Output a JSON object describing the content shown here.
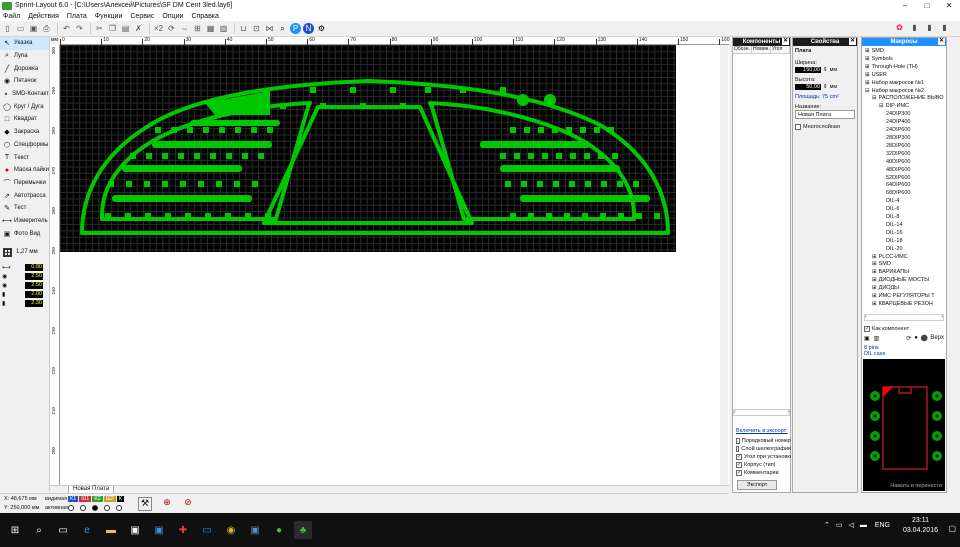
{
  "window": {
    "title": "Sprint-Layout 6.0 - [C:\\Users\\Алексей\\Pictures\\SF DM Cent 3led.lay6]"
  },
  "menu": [
    "Файл",
    "Действия",
    "Плата",
    "Функции",
    "Сервис",
    "Опции",
    "Справка"
  ],
  "tools": [
    {
      "label": "Указка",
      "icon": "pointer-icon",
      "selected": true
    },
    {
      "label": "Лупа",
      "icon": "magnifier-icon"
    },
    {
      "label": "Дорожка",
      "icon": "track-icon"
    },
    {
      "label": "Пятачок",
      "icon": "pad-icon"
    },
    {
      "label": "SMD-Контакт",
      "icon": "smd-pad-icon"
    },
    {
      "label": "Круг / Дуга",
      "icon": "circle-arc-icon"
    },
    {
      "label": "Квадрат",
      "icon": "square-icon"
    },
    {
      "label": "Закраска",
      "icon": "fill-icon"
    },
    {
      "label": "Спецформы",
      "icon": "special-shapes-icon"
    },
    {
      "label": "Текст",
      "icon": "text-icon"
    },
    {
      "label": "Маска пайки",
      "icon": "solder-mask-icon"
    },
    {
      "label": "Перемычки",
      "icon": "jumper-icon"
    },
    {
      "label": "Автотрасса",
      "icon": "autoroute-icon"
    },
    {
      "label": "Тест",
      "icon": "test-icon"
    },
    {
      "label": "Измеритель",
      "icon": "measure-icon"
    },
    {
      "label": "Фото Вид",
      "icon": "photo-view-icon"
    }
  ],
  "grid": {
    "label": "1,27 мм"
  },
  "widths": [
    "0.80",
    "2.50",
    "2.50",
    "2.00",
    "2.30"
  ],
  "ruler": {
    "unit": "мм",
    "ticks": [
      "0",
      "10",
      "20",
      "30",
      "40",
      "50",
      "60",
      "70",
      "80",
      "90",
      "100",
      "110",
      "120",
      "130",
      "140",
      "150",
      "160"
    ]
  },
  "ruler_left": [
    "300",
    "290",
    "280",
    "270",
    "260",
    "250",
    "240",
    "230",
    "220",
    "210",
    "200"
  ],
  "tab": "Новая Плата",
  "status": {
    "x": "48,675 мм",
    "y": "250,000 мм",
    "visible_label": "видимая",
    "active_label": "активная",
    "layers": [
      "К1",
      "Ш1",
      "К2",
      "Ш2",
      "К"
    ]
  },
  "components": {
    "title": "Компоненты",
    "cols": [
      "Обозн.",
      "Номин.",
      "Угол"
    ],
    "export_link": "Включить в экспорт:",
    "options": [
      {
        "label": "Порядковый номер",
        "checked": false
      },
      {
        "label": "Слой шелкографии",
        "checked": false
      },
      {
        "label": "Угол при установке",
        "checked": true
      },
      {
        "label": "Корпус (тип)",
        "checked": true
      },
      {
        "label": "Комментарии",
        "checked": true
      }
    ],
    "export_button": "Экспорт"
  },
  "properties": {
    "title": "Свойства",
    "section": "Плата",
    "width_label": "Ширина:",
    "width": "150,00",
    "height_label": "Высота:",
    "height": "50,00",
    "unit": "мм",
    "area": "Площадь: 75 cm²",
    "name_label": "Название:",
    "name": "Новая Плата",
    "multilayer": "Многослойная"
  },
  "macros": {
    "title": "Макросы",
    "tree": [
      {
        "t": "SMD",
        "d": 0,
        "s": "+"
      },
      {
        "t": "Symbols",
        "d": 0,
        "s": "+"
      },
      {
        "t": "Through-Hole (TH)",
        "d": 0,
        "s": "+"
      },
      {
        "t": "USER",
        "d": 0,
        "s": "+"
      },
      {
        "t": "Набор макросов №1",
        "d": 0,
        "s": "+"
      },
      {
        "t": "Набор макросов №2",
        "d": 0,
        "s": "-"
      },
      {
        "t": "РАСПОЛОЖЕНИЕ ВЫВО",
        "d": 1,
        "s": "-"
      },
      {
        "t": "DIP-ИМС",
        "d": 2,
        "s": "-"
      },
      {
        "t": "24DIP300",
        "d": 3,
        "s": ""
      },
      {
        "t": "24DIP400",
        "d": 3,
        "s": ""
      },
      {
        "t": "24DIP600",
        "d": 3,
        "s": ""
      },
      {
        "t": "28DIP300",
        "d": 3,
        "s": ""
      },
      {
        "t": "28DIP600",
        "d": 3,
        "s": ""
      },
      {
        "t": "32DIP600",
        "d": 3,
        "s": ""
      },
      {
        "t": "40DIP600",
        "d": 3,
        "s": ""
      },
      {
        "t": "48DIP600",
        "d": 3,
        "s": ""
      },
      {
        "t": "52DIP600",
        "d": 3,
        "s": ""
      },
      {
        "t": "64DIP600",
        "d": 3,
        "s": ""
      },
      {
        "t": "68DIP600",
        "d": 3,
        "s": ""
      },
      {
        "t": "DIL-4",
        "d": 3,
        "s": ""
      },
      {
        "t": "DIL-6",
        "d": 3,
        "s": ""
      },
      {
        "t": "DIL-8",
        "d": 3,
        "s": ""
      },
      {
        "t": "DIL-14",
        "d": 3,
        "s": ""
      },
      {
        "t": "DIL-16",
        "d": 3,
        "s": ""
      },
      {
        "t": "DIL-18",
        "d": 3,
        "s": ""
      },
      {
        "t": "DIL-20",
        "d": 3,
        "s": ""
      },
      {
        "t": "PLCC-ИМС",
        "d": 1,
        "s": "+"
      },
      {
        "t": "SMD",
        "d": 1,
        "s": "+"
      },
      {
        "t": "ВАРИКАПЫ",
        "d": 1,
        "s": "+"
      },
      {
        "t": "ДИОДНЫЕ МОСТЫ",
        "d": 1,
        "s": "+"
      },
      {
        "t": "ДИОДЫ",
        "d": 1,
        "s": "+"
      },
      {
        "t": "ИМС РЕГУЛЯТОРЫ Т",
        "d": 1,
        "s": "+"
      },
      {
        "t": "КВАРЦЕВЫЕ РЕЗОН",
        "d": 1,
        "s": "+"
      }
    ],
    "as_component": "Как компонент",
    "top": "Верх",
    "pins": "8 pins",
    "case": "DIL case",
    "hint": "Нажать и перенести"
  },
  "taskbar": {
    "lang": "ENG",
    "time": "23:11",
    "date": "03.04.2016"
  },
  "colors": {
    "copper": "#00c800",
    "board": "#000000",
    "accent": "#1e90ff"
  }
}
